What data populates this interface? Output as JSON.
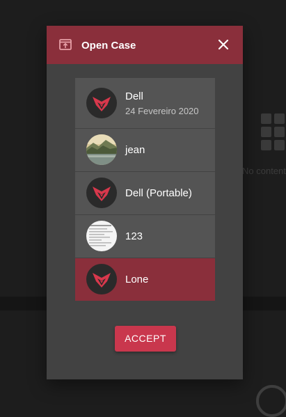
{
  "background": {
    "empty_text": "No content"
  },
  "dialog": {
    "title": "Open Case",
    "header_icon": "open-folder-icon",
    "close_icon": "close-icon",
    "accept_label": "ACCEPT",
    "colors": {
      "header": "#8a2f3b",
      "selected": "#8a2f3b",
      "accent": "#c9374d",
      "item": "#545454",
      "body": "#424242"
    }
  },
  "cases": [
    {
      "name": "Dell",
      "date": "24 Fevereiro 2020",
      "avatar": "app-logo",
      "selected": false
    },
    {
      "name": "jean",
      "avatar": "landscape-photo",
      "selected": false
    },
    {
      "name": "Dell (Portable)",
      "avatar": "app-logo",
      "selected": false
    },
    {
      "name": "123",
      "avatar": "document-thumbnail",
      "selected": false
    },
    {
      "name": "Lone",
      "avatar": "app-logo",
      "selected": true
    }
  ]
}
